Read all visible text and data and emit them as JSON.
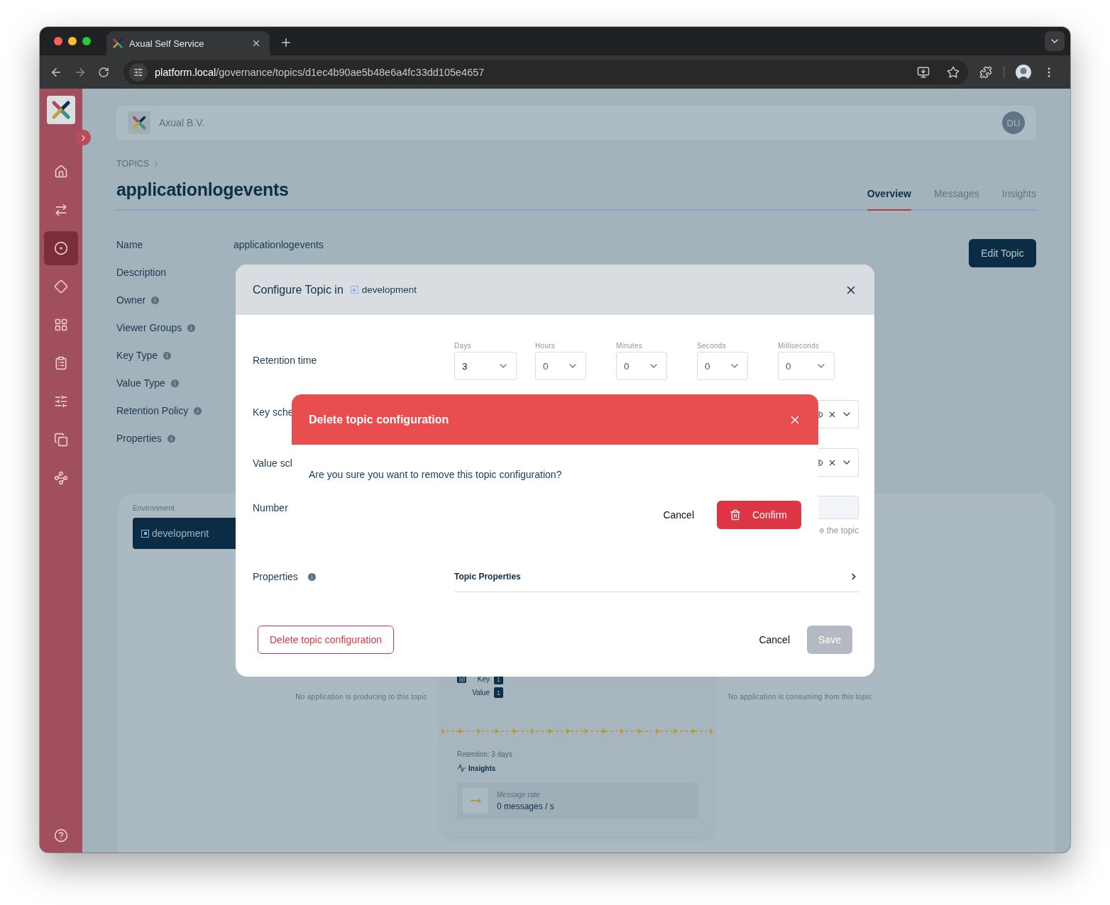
{
  "browser": {
    "tab_title": "Axual Self Service",
    "url_host": "platform.local",
    "url_path": "/governance/topics/d1ec4b90ae5b48e6a4fc33dd105e4657"
  },
  "sidebar": {
    "items": [
      {
        "kind": "home",
        "selected": false
      },
      {
        "kind": "streams",
        "selected": false
      },
      {
        "kind": "topics",
        "selected": true
      },
      {
        "kind": "apps",
        "selected": false
      },
      {
        "kind": "grid",
        "selected": false
      },
      {
        "kind": "clipboard",
        "selected": false
      },
      {
        "kind": "sliders",
        "selected": false
      },
      {
        "kind": "copy",
        "selected": false
      },
      {
        "kind": "nodes",
        "selected": false
      }
    ]
  },
  "header": {
    "org": "Axual B.V.",
    "avatar": "DU"
  },
  "breadcrumb": [
    "TOPICS"
  ],
  "title": "applicationlogevents",
  "tabs": [
    {
      "label": "Overview",
      "selected": true
    },
    {
      "label": "Messages",
      "selected": false
    },
    {
      "label": "Insights",
      "selected": false
    }
  ],
  "edit_button": "Edit Topic",
  "details": [
    {
      "label": "Name",
      "info": false,
      "value": "applicationlogevents"
    },
    {
      "label": "Description",
      "info": false
    },
    {
      "label": "Owner",
      "info": true
    },
    {
      "label": "Viewer Groups",
      "info": true
    },
    {
      "label": "Key Type",
      "info": true
    },
    {
      "label": "Value Type",
      "info": true
    },
    {
      "label": "Retention Policy",
      "info": true
    },
    {
      "label": "Properties",
      "info": true
    }
  ],
  "environment": {
    "label": "Environment",
    "button": "development"
  },
  "producers_note": "No application is producing to this topic",
  "consumers_note": "No application is consuming from this topic",
  "topic_card": {
    "schemas": [
      {
        "label": "Key",
        "count": "1"
      },
      {
        "label": "Value",
        "count": "1"
      }
    ],
    "retention": "Retention: 3 days",
    "insights": "Insights",
    "metric": {
      "label": "Message rate",
      "value": "0 messages / s"
    }
  },
  "configure_modal": {
    "title": "Configure Topic in",
    "environment": "development",
    "retention": {
      "label": "Retention time",
      "units": [
        {
          "label": "Days",
          "value": "3"
        },
        {
          "label": "Hours",
          "value": "0"
        },
        {
          "label": "Minutes",
          "value": "0"
        },
        {
          "label": "Seconds",
          "value": "0"
        },
        {
          "label": "Milliseconds",
          "value": "0"
        }
      ]
    },
    "key_label": "Key sche",
    "value_label": "Value scl",
    "number_label": "Number",
    "number_hint": "e the topic",
    "properties": {
      "label": "Properties",
      "link": "Topic Properties"
    },
    "delete_button": "Delete topic configuration",
    "cancel": "Cancel",
    "save": {
      "label": "Save",
      "disabled": true
    }
  },
  "delete_dialog": {
    "title": "Delete topic configuration",
    "message": "Are you sure you want to remove this topic configuration?",
    "cancel": "Cancel",
    "confirm": "Confirm"
  }
}
